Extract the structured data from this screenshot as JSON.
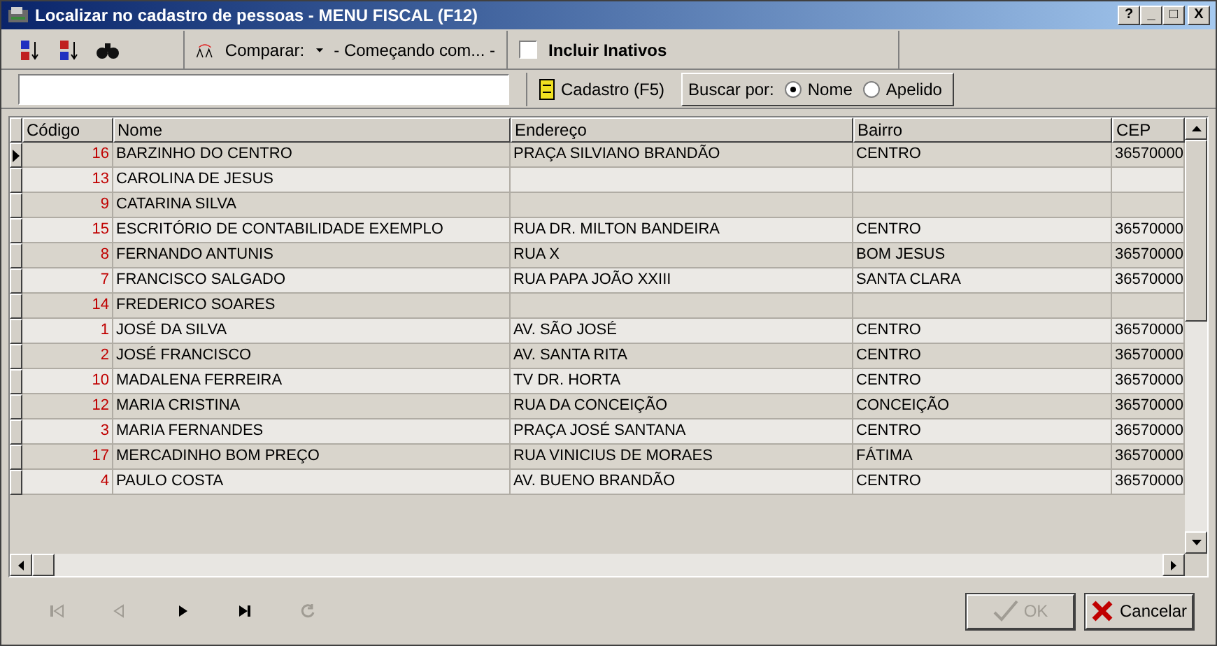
{
  "window": {
    "title": "Localizar no cadastro de pessoas - MENU FISCAL (F12)",
    "controls": [
      "?",
      "_",
      "□",
      "X"
    ]
  },
  "toolbar": {
    "compare_label": "Comparar:",
    "compare_mode": "- Começando com... -",
    "include_inactive": {
      "label": "Incluir Inativos",
      "checked": false
    }
  },
  "register_button": "Cadastro (F5)",
  "search_by": {
    "label": "Buscar por:",
    "options": [
      {
        "label": "Nome",
        "selected": true
      },
      {
        "label": "Apelido",
        "selected": false
      }
    ]
  },
  "table": {
    "columns": [
      "Código",
      "Nome",
      "Endereço",
      "Bairro",
      "CEP"
    ],
    "rows": [
      {
        "selected": true,
        "cells": [
          "16",
          "BARZINHO DO CENTRO",
          "PRAÇA SILVIANO BRANDÃO",
          "CENTRO",
          "36570000"
        ]
      },
      {
        "selected": false,
        "cells": [
          "13",
          "CAROLINA DE JESUS",
          "",
          "",
          ""
        ]
      },
      {
        "selected": false,
        "cells": [
          "9",
          "CATARINA SILVA",
          "",
          "",
          ""
        ]
      },
      {
        "selected": false,
        "cells": [
          "15",
          "ESCRITÓRIO DE CONTABILIDADE EXEMPLO",
          "RUA DR. MILTON BANDEIRA",
          "CENTRO",
          "36570000"
        ]
      },
      {
        "selected": false,
        "cells": [
          "8",
          "FERNANDO ANTUNIS",
          "RUA X",
          "BOM JESUS",
          "36570000"
        ]
      },
      {
        "selected": false,
        "cells": [
          "7",
          "FRANCISCO SALGADO",
          "RUA PAPA JOÃO XXIII",
          "SANTA CLARA",
          "36570000"
        ]
      },
      {
        "selected": false,
        "cells": [
          "14",
          "FREDERICO SOARES",
          "",
          "",
          ""
        ]
      },
      {
        "selected": false,
        "cells": [
          "1",
          "JOSÉ DA SILVA",
          "AV. SÃO JOSÉ",
          "CENTRO",
          "36570000"
        ]
      },
      {
        "selected": false,
        "cells": [
          "2",
          "JOSÉ FRANCISCO",
          "AV. SANTA RITA",
          "CENTRO",
          "36570000"
        ]
      },
      {
        "selected": false,
        "cells": [
          "10",
          "MADALENA FERREIRA",
          "TV DR. HORTA",
          "CENTRO",
          "36570000"
        ]
      },
      {
        "selected": false,
        "cells": [
          "12",
          "MARIA CRISTINA",
          "RUA DA CONCEIÇÃO",
          "CONCEIÇÃO",
          "36570000"
        ]
      },
      {
        "selected": false,
        "cells": [
          "3",
          "MARIA FERNANDES",
          "PRAÇA JOSÉ SANTANA",
          "CENTRO",
          "36570000"
        ]
      },
      {
        "selected": false,
        "cells": [
          "17",
          "MERCADINHO BOM PREÇO",
          "RUA VINICIUS DE MORAES",
          "FÁTIMA",
          "36570000"
        ]
      },
      {
        "selected": false,
        "cells": [
          "4",
          "PAULO COSTA",
          "AV. BUENO BRANDÃO",
          "CENTRO",
          "36570000"
        ]
      }
    ]
  },
  "navigator": [
    {
      "kind": "first",
      "disabled": true
    },
    {
      "kind": "prior",
      "disabled": true
    },
    {
      "kind": "next",
      "disabled": false
    },
    {
      "kind": "last",
      "disabled": false
    },
    {
      "kind": "refresh",
      "disabled": true
    }
  ],
  "buttons": [
    {
      "kind": "ok",
      "label": "OK",
      "disabled": true
    },
    {
      "kind": "cancel",
      "label": "Cancelar",
      "disabled": false
    }
  ]
}
